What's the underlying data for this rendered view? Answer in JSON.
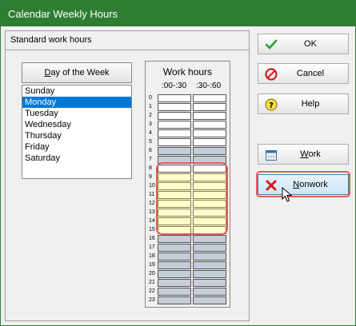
{
  "window": {
    "title": "Calendar Weekly Hours"
  },
  "panel": {
    "header": "Standard work hours"
  },
  "day_of_week": {
    "header_prefix": "",
    "header_underlined": "D",
    "header_rest": "ay of the Week",
    "items": [
      "Sunday",
      "Monday",
      "Tuesday",
      "Wednesday",
      "Thursday",
      "Friday",
      "Saturday"
    ],
    "selected": "Monday"
  },
  "work_hours": {
    "title": "Work hours",
    "col1": ":00-:30",
    "col2": ":30-:60",
    "hours": [
      "0",
      "1",
      "2",
      "3",
      "4",
      "5",
      "6",
      "7",
      "8",
      "9",
      "10",
      "11",
      "12",
      "13",
      "14",
      "15",
      "16",
      "17",
      "18",
      "19",
      "20",
      "21",
      "22",
      "23"
    ],
    "states": [
      "work",
      "work",
      "work",
      "work",
      "work",
      "work",
      "nonwork",
      "nonwork",
      "work",
      "sel",
      "sel",
      "sel",
      "sel",
      "sel",
      "sel",
      "sel",
      "nonwork",
      "nonwork",
      "nonwork",
      "nonwork",
      "nonwork",
      "nonwork",
      "nonwork",
      "nonwork"
    ]
  },
  "buttons": {
    "ok": "OK",
    "cancel": "Cancel",
    "help": "Help",
    "work_u": "W",
    "work_rest": "ork",
    "nonwork_u": "N",
    "nonwork_rest": "onwork"
  },
  "colors": {
    "title_bar": "#2e7d32",
    "selection": "#0078d7",
    "highlight": "#e85a5a",
    "nonwork_cell": "#c5cdd8",
    "selected_cell": "#ffffcc"
  }
}
